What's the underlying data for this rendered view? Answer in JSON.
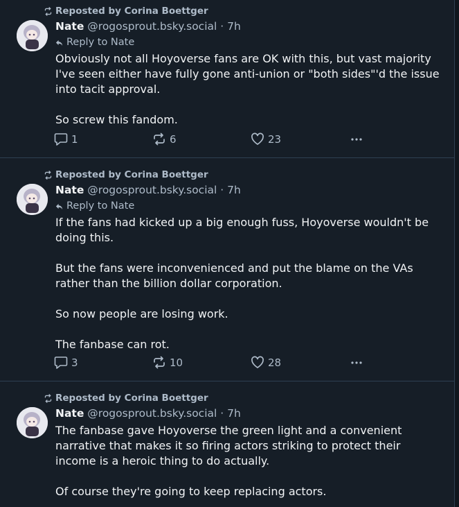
{
  "posts": [
    {
      "repost_label": "Reposted by Corina Boettger",
      "author_name": "Nate",
      "author_handle": "@rogosprout.bsky.social",
      "time": "· 7h",
      "reply_to": "Reply to Nate",
      "paragraphs": [
        "Obviously not all Hoyoverse fans are OK with this, but vast majority I've seen either have fully gone anti-union or \"both sides\"'d the issue into tacit approval.",
        "So screw this fandom."
      ],
      "replies": "1",
      "reposts": "6",
      "likes": "23"
    },
    {
      "repost_label": "Reposted by Corina Boettger",
      "author_name": "Nate",
      "author_handle": "@rogosprout.bsky.social",
      "time": "· 7h",
      "reply_to": "Reply to Nate",
      "paragraphs": [
        "If the fans had kicked up a big enough fuss, Hoyoverse wouldn't be doing this.",
        "But the fans were inconvenienced and put the blame on the VAs rather than the billion dollar corporation.",
        "So now people are losing work.",
        "The fanbase can rot."
      ],
      "replies": "3",
      "reposts": "10",
      "likes": "28"
    },
    {
      "repost_label": "Reposted by Corina Boettger",
      "author_name": "Nate",
      "author_handle": "@rogosprout.bsky.social",
      "time": "· 7h",
      "paragraphs": [
        "The fanbase gave Hoyoverse the green light and a convenient narrative that makes it so firing actors striking to protect their income is a heroic thing to do actually.",
        "Of course they're going to keep replacing actors."
      ]
    }
  ],
  "icons": {
    "repost": "repost-icon",
    "reply": "reply-arrow-icon",
    "comment": "comment-icon",
    "like": "heart-icon",
    "more": "more-options-icon"
  },
  "colors": {
    "background": "#161e27",
    "divider": "#2e4052",
    "secondary_text": "#aebbc9",
    "primary_text": "#f1f3f5"
  }
}
